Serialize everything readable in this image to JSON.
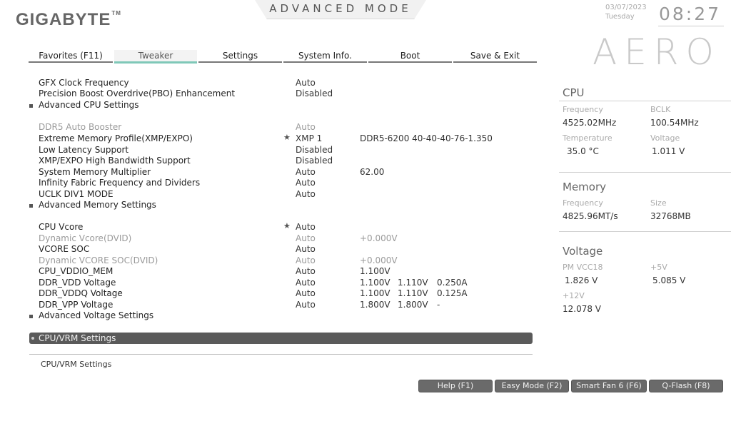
{
  "header": {
    "brand": "GIGABYTE",
    "brand_tm": "TM",
    "mode": "ADVANCED MODE",
    "date": "03/07/2023",
    "day": "Tuesday",
    "time": "08:27",
    "product": "AERO"
  },
  "tabs": [
    {
      "label": "Favorites (F11)"
    },
    {
      "label": "Tweaker",
      "active": true
    },
    {
      "label": "Settings"
    },
    {
      "label": "System Info."
    },
    {
      "label": "Boot"
    },
    {
      "label": "Save & Exit"
    }
  ],
  "settings": [
    {
      "label": "GFX Clock Frequency",
      "value": "Auto"
    },
    {
      "label": "Precision Boost Overdrive(PBO) Enhancement",
      "value": "Disabled"
    },
    {
      "label": "Advanced CPU Settings",
      "submenu": true
    },
    {
      "label": "DDR5 Auto Booster",
      "value": "Auto",
      "dim": true
    },
    {
      "label": "Extreme Memory Profile(XMP/EXPO)",
      "value": "XMP 1",
      "starred": true,
      "extra1": "DDR5-6200 40-40-40-76-1.350"
    },
    {
      "label": "Low Latency Support",
      "value": "Disabled"
    },
    {
      "label": "XMP/EXPO High Bandwidth Support",
      "value": "Disabled"
    },
    {
      "label": "System Memory Multiplier",
      "value": "Auto",
      "extra1": "62.00"
    },
    {
      "label": "Infinity Fabric Frequency and Dividers",
      "value": "Auto"
    },
    {
      "label": "UCLK DIV1 MODE",
      "value": "Auto"
    },
    {
      "label": "Advanced Memory Settings",
      "submenu": true
    },
    {
      "label": "CPU Vcore",
      "value": "Auto",
      "starred": true
    },
    {
      "label": "Dynamic Vcore(DVID)",
      "value": "Auto",
      "dim": true,
      "extra1": "+0.000V"
    },
    {
      "label": "VCORE SOC",
      "value": "Auto"
    },
    {
      "label": "Dynamic VCORE SOC(DVID)",
      "value": "Auto",
      "dim": true,
      "extra1": "+0.000V"
    },
    {
      "label": "CPU_VDDIO_MEM",
      "value": "Auto",
      "extra1": "1.100V"
    },
    {
      "label": "DDR_VDD Voltage",
      "value": "Auto",
      "extra1": "1.100V",
      "extra2": "1.110V",
      "extra3": "0.250A"
    },
    {
      "label": "DDR_VDDQ Voltage",
      "value": "Auto",
      "extra1": "1.100V",
      "extra2": "1.110V",
      "extra3": "0.125A"
    },
    {
      "label": "DDR_VPP Voltage",
      "value": "Auto",
      "extra1": "1.800V",
      "extra2": "1.800V",
      "extra3": "-"
    },
    {
      "label": "Advanced Voltage Settings",
      "submenu": true
    }
  ],
  "selected_item": "CPU/VRM Settings",
  "help_text": "CPU/VRM Settings",
  "right_panel": {
    "cpu": {
      "title": "CPU",
      "frequency_label": "Frequency",
      "frequency": "4525.02MHz",
      "bclk_label": "BCLK",
      "bclk": "100.54MHz",
      "temperature_label": "Temperature",
      "temperature": "35.0 °C",
      "voltage_label": "Voltage",
      "voltage": "1.011 V"
    },
    "memory": {
      "title": "Memory",
      "frequency_label": "Frequency",
      "frequency": "4825.96MT/s",
      "size_label": "Size",
      "size": "32768MB"
    },
    "voltage": {
      "title": "Voltage",
      "pm_vcc18_label": "PM VCC18",
      "pm_vcc18": "1.826 V",
      "p5v_label": "+5V",
      "p5v": "5.085 V",
      "p12v_label": "+12V",
      "p12v": "12.078 V"
    }
  },
  "footer_buttons": [
    {
      "label": "Help (F1)"
    },
    {
      "label": "Easy Mode (F2)"
    },
    {
      "label": "Smart Fan 6 (F6)"
    },
    {
      "label": "Q-Flash (F8)"
    }
  ],
  "colors": {
    "accent": "#7fc8b8",
    "highlight_bar": "#5a5a5a",
    "button_bg": "#6a6a6a"
  }
}
